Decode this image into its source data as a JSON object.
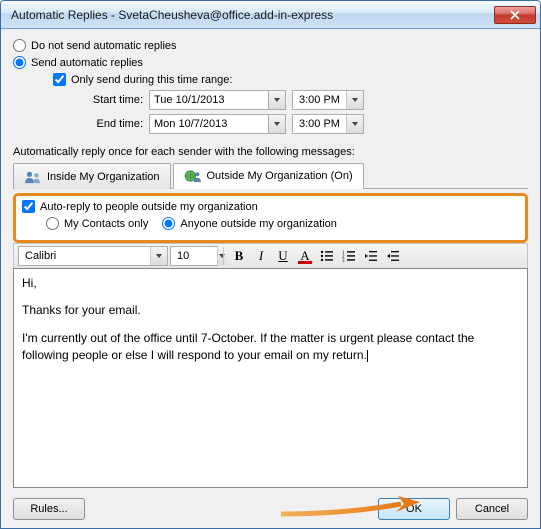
{
  "window": {
    "title": "Automatic Replies - SvetaCheusheva@office.add-in-express"
  },
  "options": {
    "do_not_send": "Do not send automatic replies",
    "send": "Send automatic replies",
    "only_range": "Only send during this time range:",
    "start_label": "Start time:",
    "start_date": "Tue 10/1/2013",
    "start_time": "3:00 PM",
    "end_label": "End time:",
    "end_date": "Mon 10/7/2013",
    "end_time": "3:00 PM"
  },
  "section_text": "Automatically reply once for each sender with the following messages:",
  "tabs": {
    "inside": "Inside My Organization",
    "outside": "Outside My Organization (On)"
  },
  "outside_panel": {
    "auto_reply": "Auto-reply to people outside my organization",
    "contacts_only": "My Contacts only",
    "anyone": "Anyone outside my organization"
  },
  "toolbar": {
    "font": "Calibri",
    "size": "10",
    "bold": "B",
    "italic": "I",
    "underline": "U",
    "color_letter": "A"
  },
  "editor": {
    "p1": "Hi,",
    "p2": "Thanks for your email.",
    "p3": "I'm currently out of the office until 7-October. If the matter is urgent please contact the following people or else I will respond to your email on my return."
  },
  "buttons": {
    "rules": "Rules...",
    "ok": "OK",
    "cancel": "Cancel"
  }
}
